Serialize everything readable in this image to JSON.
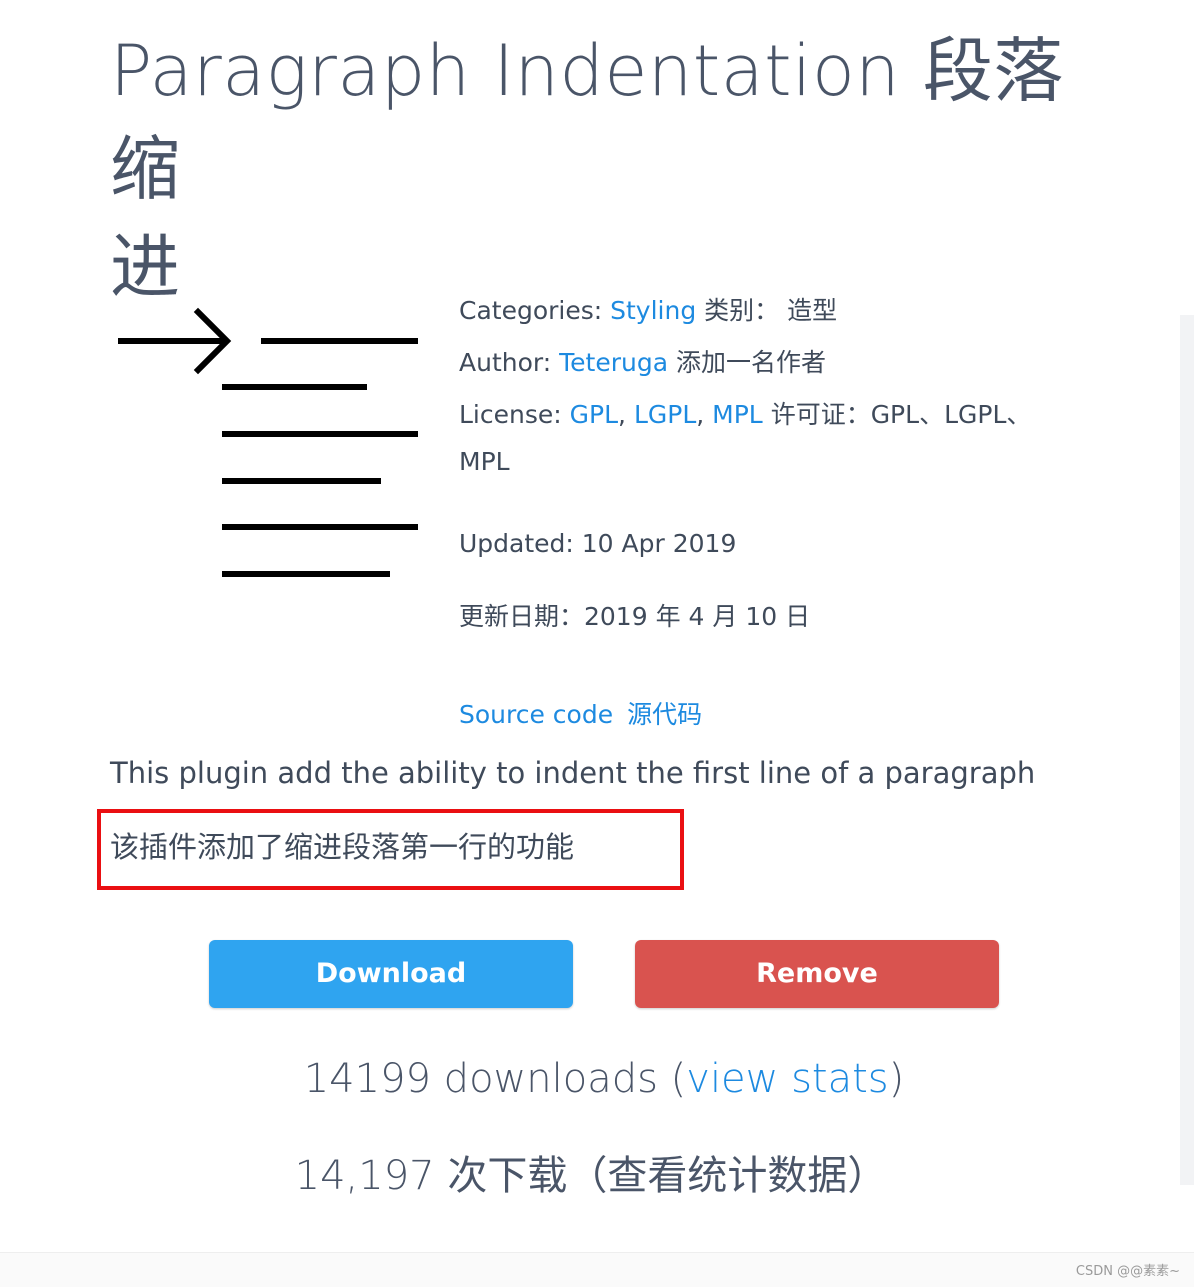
{
  "page": {
    "title_line1": "Paragraph Indentation  段落缩",
    "title_line2": "进"
  },
  "plugin_icon": "paragraph-indent-icon",
  "meta": {
    "categories_label": "Categories:",
    "categories_link": "Styling",
    "categories_zh": "类别：  造型",
    "author_label": "Author:",
    "author_link": "Teteruga",
    "author_zh": "添加一名作者",
    "license_label": "License:",
    "license_links": [
      "GPL",
      "LGPL",
      "MPL"
    ],
    "license_sep": ",",
    "license_zh": "许可证：GPL、LGPL、",
    "license_zh_cont": "MPL",
    "updated": "Updated: 10 Apr 2019",
    "updated_zh": "更新日期：2019 年 4 月 10 日",
    "source_code_link": "Source code",
    "source_code_zh": "源代码"
  },
  "description": {
    "en": "This plugin add the ability to indent the first line of a paragraph",
    "zh": "该插件添加了缩进段落第一行的功能"
  },
  "buttons": {
    "download_label": "Download",
    "remove_label": "Remove"
  },
  "stats": {
    "downloads_text": "14199 downloads (",
    "view_stats_link": "view stats",
    "close_paren": ")",
    "downloads_zh": "14,197 次下载（查看统计数据）"
  },
  "footer": {
    "watermark": "CSDN @@素素~"
  },
  "colors": {
    "link": "#1d8ae0",
    "download_button": "#2fa4f0",
    "remove_button": "#d9534f",
    "highlight_border": "#ea0f12",
    "text": "#3f4a5a"
  }
}
